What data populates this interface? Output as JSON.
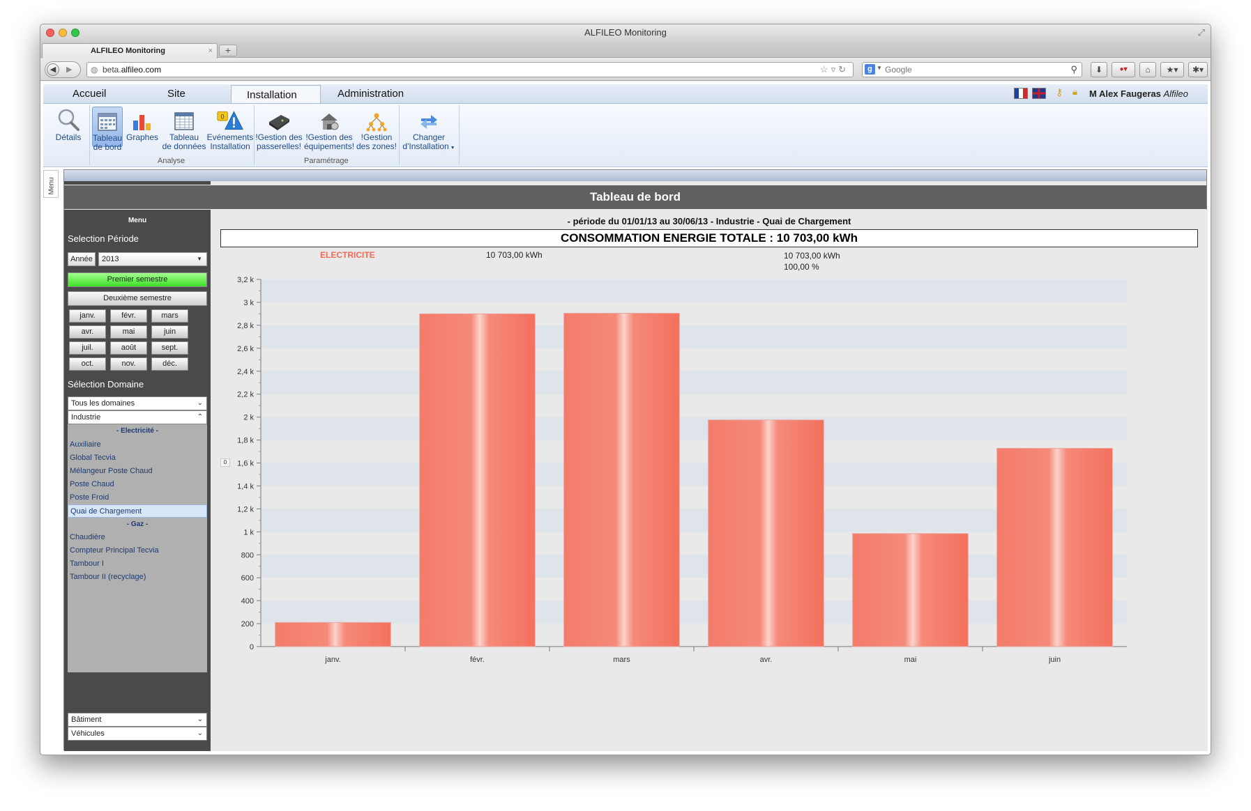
{
  "window": {
    "title": "ALFILEO Monitoring"
  },
  "browser": {
    "tab_title": "ALFILEO Monitoring",
    "newtab_label": "+",
    "url_prefix": "beta.",
    "url_domain": "alfileo.com",
    "search_placeholder": "Google"
  },
  "app": {
    "tabs": [
      {
        "label": "Accueil"
      },
      {
        "label": "Site"
      },
      {
        "label": "Installation",
        "active": true
      },
      {
        "label": "Administration"
      }
    ],
    "user": {
      "name": "M Alex Faugeras",
      "org": "Alfileo"
    }
  },
  "ribbon": {
    "buttons": [
      {
        "label1": "Détails",
        "label2": ""
      },
      {
        "label1": "Tableau",
        "label2": "de bord"
      },
      {
        "label1": "Graphes",
        "label2": ""
      },
      {
        "label1": "Tableau",
        "label2": "de données"
      },
      {
        "label1": "Evénements",
        "label2": "Installation",
        "badge": "0"
      },
      {
        "label1": "!Gestion des",
        "label2": "passerelles!"
      },
      {
        "label1": "!Gestion des",
        "label2": "équipements!"
      },
      {
        "label1": "!Gestion",
        "label2": "des zones!"
      },
      {
        "label1": "Changer",
        "label2": "d'Installation"
      }
    ],
    "groups": {
      "analyse": "Analyse",
      "parametrage": "Paramétrage"
    }
  },
  "menu_strip": "Menu",
  "page_title": "Tableau de bord",
  "sidebar": {
    "menu_title": "Menu",
    "periode_title": "Selection Période",
    "annee_label": "Année",
    "year_value": "2013",
    "premier_semestre": "Premier semestre",
    "deuxieme_semestre": "Deuxième semestre",
    "months": [
      "janv.",
      "févr.",
      "mars",
      "avr.",
      "mai",
      "juin",
      "juil.",
      "août",
      "sept.",
      "oct.",
      "nov.",
      "déc."
    ],
    "domaine_title": "Sélection Domaine",
    "domain_select": "Tous les domaines",
    "industrie_select": "Industrie",
    "electricite_head": "- Electricité -",
    "electricite_items": [
      "Auxiliaire",
      "Global Tecvia",
      "Mélangeur Poste Chaud",
      "Poste Chaud",
      "Poste Froid",
      "Quai de Chargement"
    ],
    "gaz_head": "- Gaz -",
    "gaz_items": [
      "Chaudière",
      "Compteur Principal Tecvia",
      "Tambour I",
      "Tambour II (recyclage)"
    ],
    "batiment_select": "Bâtiment",
    "vehicules_select": "Véhicules"
  },
  "content": {
    "period": "- période du 01/01/13 au 30/06/13 - Industrie - Quai de Chargement",
    "total": "CONSOMMATION ENERGIE TOTALE : 10 703,00 kWh",
    "legend_name": "ELECTRICITE",
    "legend_value": "10 703,00 kWh",
    "legend_total": "10 703,00 kWh",
    "legend_percent": "100,00 %",
    "zero_tag": "0"
  },
  "chart_data": {
    "type": "bar",
    "categories": [
      "janv.",
      "févr.",
      "mars",
      "avr.",
      "mai",
      "juin"
    ],
    "series": [
      {
        "name": "ELECTRICITE",
        "values": [
          210,
          2900,
          2905,
          1975,
          985,
          1728
        ]
      }
    ],
    "ylim": [
      0,
      3200
    ],
    "yticks": [
      0,
      200,
      400,
      600,
      800,
      1000,
      1200,
      1400,
      1600,
      1800,
      2000,
      2200,
      2400,
      2600,
      2800,
      3000,
      3200
    ],
    "ytick_labels": [
      "0",
      "200",
      "400",
      "600",
      "800",
      "1 k",
      "1,2 k",
      "1,4 k",
      "1,6 k",
      "1,8 k",
      "2 k",
      "2,2 k",
      "2,4 k",
      "2,6 k",
      "2,8 k",
      "3 k",
      "3,2 k"
    ],
    "grid": "alternating horizontal bands",
    "colors": {
      "bar": "#f47b69",
      "bar_highlight": "#fcd3cb",
      "band": "#dfe3ea"
    }
  }
}
